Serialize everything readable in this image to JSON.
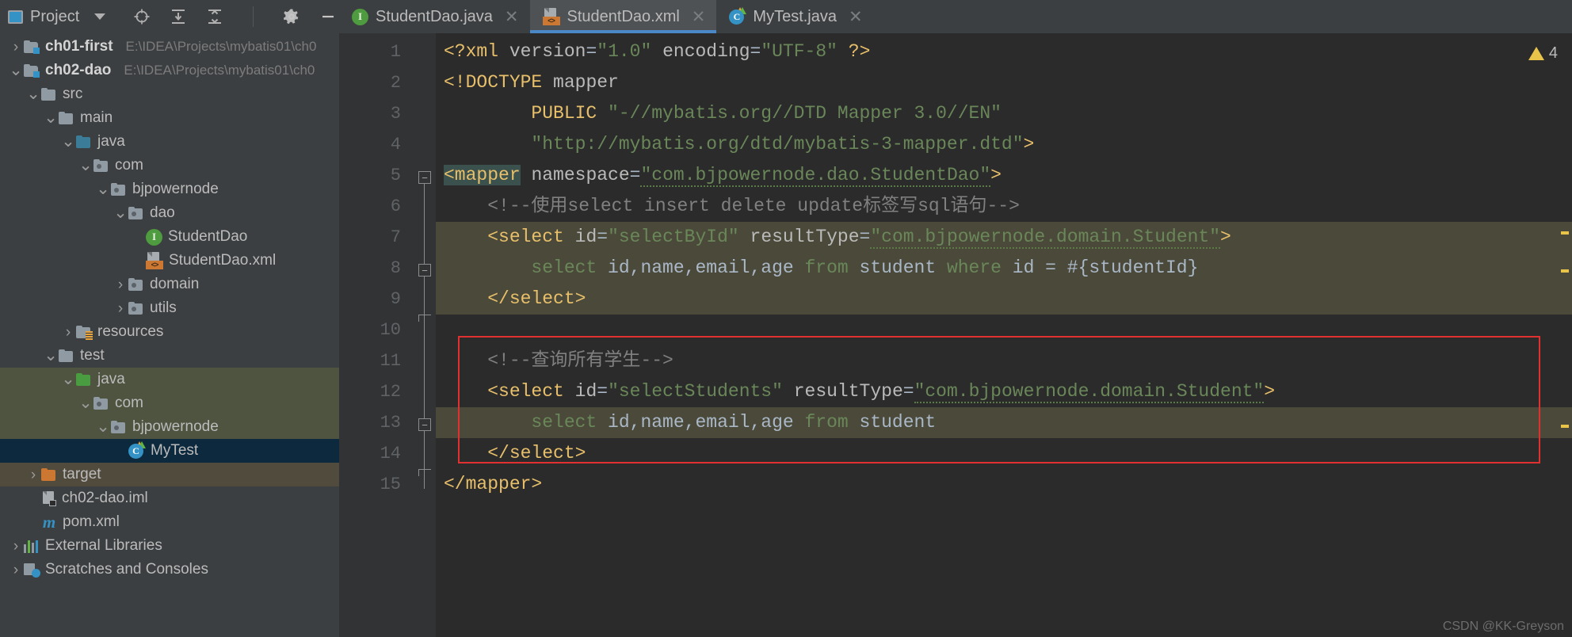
{
  "toolbar": {
    "project_label": "Project",
    "project_icon": "project-panel-icon",
    "dropdown_icon": "chevron-down-icon",
    "icons": [
      "locate-target-icon",
      "expand-all-icon",
      "collapse-all-icon",
      "settings-gear-icon",
      "hide-panel-icon"
    ]
  },
  "tabs": [
    {
      "label": "StudentDao.java",
      "icon": "java-interface-icon",
      "active": false,
      "close_icon": "close-icon"
    },
    {
      "label": "StudentDao.xml",
      "icon": "xml-file-icon",
      "active": true,
      "close_icon": "close-icon"
    },
    {
      "label": "MyTest.java",
      "icon": "java-class-icon",
      "active": false,
      "close_icon": "close-icon"
    }
  ],
  "tree": [
    {
      "indent": 0,
      "arrow": "›",
      "icon": "module-folder-icon",
      "name": "ch01-first",
      "bold": true,
      "path": "E:\\IDEA\\Projects\\mybatis01\\ch0",
      "row": "normal"
    },
    {
      "indent": 0,
      "arrow": "⌄",
      "icon": "module-folder-icon",
      "name": "ch02-dao",
      "bold": true,
      "path": "E:\\IDEA\\Projects\\mybatis01\\ch0",
      "row": "normal"
    },
    {
      "indent": 1,
      "arrow": "⌄",
      "icon": "folder-icon",
      "name": "src",
      "bold": false,
      "path": "",
      "row": "normal"
    },
    {
      "indent": 2,
      "arrow": "⌄",
      "icon": "folder-icon",
      "name": "main",
      "bold": false,
      "path": "",
      "row": "normal"
    },
    {
      "indent": 3,
      "arrow": "⌄",
      "icon": "source-root-folder-icon",
      "name": "java",
      "bold": false,
      "path": "",
      "row": "normal"
    },
    {
      "indent": 4,
      "arrow": "⌄",
      "icon": "package-folder-icon",
      "name": "com",
      "bold": false,
      "path": "",
      "row": "normal"
    },
    {
      "indent": 5,
      "arrow": "⌄",
      "icon": "package-folder-icon",
      "name": "bjpowernode",
      "bold": false,
      "path": "",
      "row": "normal"
    },
    {
      "indent": 6,
      "arrow": "⌄",
      "icon": "package-folder-icon",
      "name": "dao",
      "bold": false,
      "path": "",
      "row": "normal"
    },
    {
      "indent": 7,
      "arrow": "",
      "icon": "java-interface-icon",
      "name": "StudentDao",
      "bold": false,
      "path": "",
      "row": "normal"
    },
    {
      "indent": 7,
      "arrow": "",
      "icon": "xml-file-icon",
      "name": "StudentDao.xml",
      "bold": false,
      "path": "",
      "row": "normal"
    },
    {
      "indent": 6,
      "arrow": "›",
      "icon": "package-folder-icon",
      "name": "domain",
      "bold": false,
      "path": "",
      "row": "normal"
    },
    {
      "indent": 6,
      "arrow": "›",
      "icon": "package-folder-icon",
      "name": "utils",
      "bold": false,
      "path": "",
      "row": "normal"
    },
    {
      "indent": 3,
      "arrow": "›",
      "icon": "resources-folder-icon",
      "name": "resources",
      "bold": false,
      "path": "",
      "row": "normal"
    },
    {
      "indent": 2,
      "arrow": "⌄",
      "icon": "folder-icon",
      "name": "test",
      "bold": false,
      "path": "",
      "row": "normal"
    },
    {
      "indent": 3,
      "arrow": "⌄",
      "icon": "test-source-root-folder-icon",
      "name": "java",
      "bold": false,
      "path": "",
      "row": "sel-green"
    },
    {
      "indent": 4,
      "arrow": "⌄",
      "icon": "package-folder-icon",
      "name": "com",
      "bold": false,
      "path": "",
      "row": "sel-green"
    },
    {
      "indent": 5,
      "arrow": "⌄",
      "icon": "package-folder-icon",
      "name": "bjpowernode",
      "bold": false,
      "path": "",
      "row": "sel-green"
    },
    {
      "indent": 6,
      "arrow": "",
      "icon": "java-class-icon",
      "name": "MyTest",
      "bold": false,
      "path": "",
      "row": "sel-blue"
    },
    {
      "indent": 1,
      "arrow": "›",
      "icon": "target-folder-icon",
      "name": "target",
      "bold": false,
      "path": "",
      "row": "sel-brown"
    },
    {
      "indent": 1,
      "arrow": "",
      "icon": "iml-file-icon",
      "name": "ch02-dao.iml",
      "bold": false,
      "path": "",
      "row": "normal"
    },
    {
      "indent": 1,
      "arrow": "",
      "icon": "maven-pom-icon",
      "name": "pom.xml",
      "bold": false,
      "path": "",
      "row": "normal"
    },
    {
      "indent": 0,
      "arrow": "›",
      "icon": "external-libraries-icon",
      "name": "External Libraries",
      "bold": false,
      "path": "",
      "row": "normal"
    },
    {
      "indent": 0,
      "arrow": "›",
      "icon": "scratches-icon",
      "name": "Scratches and Consoles",
      "bold": false,
      "path": "",
      "row": "normal"
    }
  ],
  "editor": {
    "line_numbers": [
      "1",
      "2",
      "3",
      "4",
      "5",
      "6",
      "7",
      "8",
      "9",
      "10",
      "11",
      "12",
      "13",
      "14",
      "15"
    ],
    "lines": [
      {
        "n": 1,
        "highlight": false,
        "tokens": [
          {
            "t": "<?xml ",
            "c": "t-brk"
          },
          {
            "t": "version",
            "c": "t-attr"
          },
          {
            "t": "=",
            "c": "t-plain"
          },
          {
            "t": "\"1.0\"",
            "c": "t-str"
          },
          {
            "t": " ",
            "c": "t-plain"
          },
          {
            "t": "encoding",
            "c": "t-attr"
          },
          {
            "t": "=",
            "c": "t-plain"
          },
          {
            "t": "\"UTF-8\"",
            "c": "t-str"
          },
          {
            "t": " ",
            "c": "t-plain"
          },
          {
            "t": "?>",
            "c": "t-brk"
          }
        ]
      },
      {
        "n": 2,
        "highlight": false,
        "tokens": [
          {
            "t": "<!DOCTYPE ",
            "c": "t-brk"
          },
          {
            "t": "mapper",
            "c": "t-attr"
          }
        ]
      },
      {
        "n": 3,
        "highlight": false,
        "tokens": [
          {
            "t": "        ",
            "c": "t-plain"
          },
          {
            "t": "PUBLIC ",
            "c": "t-brk"
          },
          {
            "t": "\"-//mybatis.org//DTD Mapper 3.0//EN\"",
            "c": "t-str"
          }
        ]
      },
      {
        "n": 4,
        "highlight": false,
        "tokens": [
          {
            "t": "        ",
            "c": "t-plain"
          },
          {
            "t": "\"http://mybatis.org/dtd/mybatis-3-mapper.dtd\"",
            "c": "t-str"
          },
          {
            "t": ">",
            "c": "t-brk"
          }
        ]
      },
      {
        "n": 5,
        "highlight": false,
        "tokens": [
          {
            "t": "<mapper",
            "c": "t-mapper-hl"
          },
          {
            "t": " ",
            "c": "t-plain"
          },
          {
            "t": "namespace",
            "c": "t-attr"
          },
          {
            "t": "=",
            "c": "t-plain"
          },
          {
            "t": "\"com.bjpowernode.dao.StudentDao\"",
            "c": "t-str squig"
          },
          {
            "t": ">",
            "c": "t-brk"
          }
        ]
      },
      {
        "n": 6,
        "highlight": false,
        "tokens": [
          {
            "t": "    ",
            "c": "t-plain"
          },
          {
            "t": "<!--使用select insert delete update标签写sql语句-->",
            "c": "t-cmt"
          }
        ]
      },
      {
        "n": 7,
        "highlight": true,
        "tokens": [
          {
            "t": "    ",
            "c": "t-plain"
          },
          {
            "t": "<select ",
            "c": "t-tag"
          },
          {
            "t": "id",
            "c": "t-attr"
          },
          {
            "t": "=",
            "c": "t-plain"
          },
          {
            "t": "\"selectById\"",
            "c": "t-str"
          },
          {
            "t": " ",
            "c": "t-plain"
          },
          {
            "t": "resultType",
            "c": "t-attr"
          },
          {
            "t": "=",
            "c": "t-plain"
          },
          {
            "t": "\"com.bjpowernode.domain.Student\"",
            "c": "t-str squig"
          },
          {
            "t": ">",
            "c": "t-brk"
          }
        ]
      },
      {
        "n": 8,
        "highlight": true,
        "tokens": [
          {
            "t": "        ",
            "c": "t-plain"
          },
          {
            "t": "select ",
            "c": "t-str"
          },
          {
            "t": "id,name,email,age ",
            "c": "t-txt"
          },
          {
            "t": "from ",
            "c": "t-str"
          },
          {
            "t": "student ",
            "c": "t-txt"
          },
          {
            "t": "where ",
            "c": "t-str"
          },
          {
            "t": "id = #{studentId}",
            "c": "t-txt"
          }
        ]
      },
      {
        "n": 9,
        "highlight": true,
        "tokens": [
          {
            "t": "    ",
            "c": "t-plain"
          },
          {
            "t": "</select>",
            "c": "t-tag"
          }
        ]
      },
      {
        "n": 10,
        "highlight": false,
        "tokens": [
          {
            "t": "",
            "c": "t-plain"
          }
        ]
      },
      {
        "n": 11,
        "highlight": false,
        "tokens": [
          {
            "t": "    ",
            "c": "t-plain"
          },
          {
            "t": "<!--查询所有学生-->",
            "c": "t-cmt"
          }
        ]
      },
      {
        "n": 12,
        "highlight": false,
        "tokens": [
          {
            "t": "    ",
            "c": "t-plain"
          },
          {
            "t": "<select ",
            "c": "t-tag"
          },
          {
            "t": "id",
            "c": "t-attr"
          },
          {
            "t": "=",
            "c": "t-plain"
          },
          {
            "t": "\"selectStudents\"",
            "c": "t-str"
          },
          {
            "t": " ",
            "c": "t-plain"
          },
          {
            "t": "resultType",
            "c": "t-attr"
          },
          {
            "t": "=",
            "c": "t-plain"
          },
          {
            "t": "\"com.bjpowernode.domain.Student\"",
            "c": "t-str squig"
          },
          {
            "t": ">",
            "c": "t-brk"
          }
        ]
      },
      {
        "n": 13,
        "highlight": true,
        "tokens": [
          {
            "t": "        ",
            "c": "t-plain"
          },
          {
            "t": "select ",
            "c": "t-str"
          },
          {
            "t": "id,name,email,age ",
            "c": "t-txt"
          },
          {
            "t": "from ",
            "c": "t-str"
          },
          {
            "t": "student",
            "c": "t-txt"
          }
        ]
      },
      {
        "n": 14,
        "highlight": false,
        "tokens": [
          {
            "t": "    ",
            "c": "t-plain"
          },
          {
            "t": "</select>",
            "c": "t-tag"
          }
        ]
      },
      {
        "n": 15,
        "highlight": false,
        "tokens": [
          {
            "t": "</mapper>",
            "c": "t-tag"
          }
        ]
      }
    ],
    "warning_count": "4",
    "warning_icon": "warning-triangle-icon",
    "watermark": "CSDN @KK-Greyson"
  },
  "colors": {
    "accent": "#4a88c7",
    "tag": "#e8bf6a",
    "string": "#6a8759",
    "comment": "#808080",
    "highlight_line": "#4b4a3a",
    "red_box": "#e03030",
    "selection_blue": "#0d293e",
    "selection_green": "#4e5440",
    "selection_brown": "#514b3d"
  }
}
